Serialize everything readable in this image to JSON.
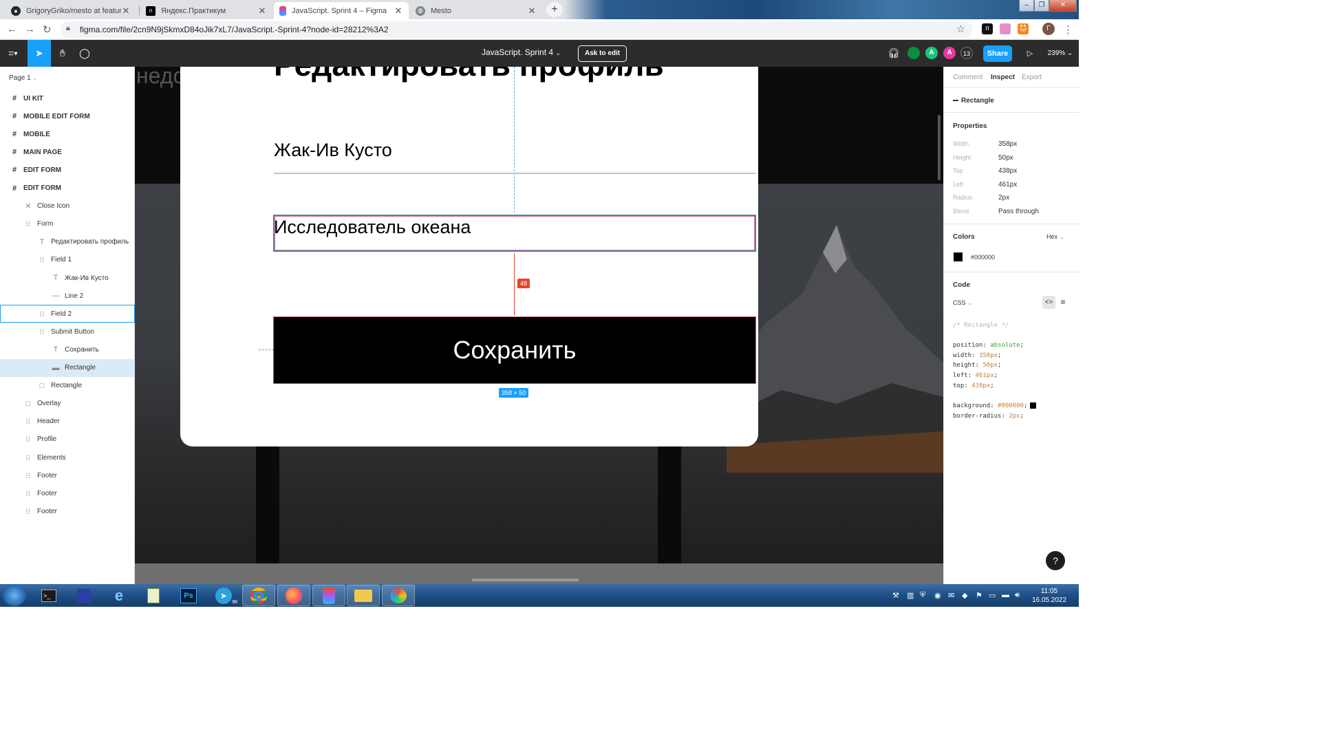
{
  "browser": {
    "tabs": [
      {
        "label": "GrigoryGriko/mesto at feature/he",
        "icon": "github-icon"
      },
      {
        "label": "Яндекс.Практикум",
        "icon": "yandex-praktikum-icon"
      },
      {
        "label": "JavaScript. Sprint 4 – Figma",
        "icon": "figma-icon",
        "active": true
      },
      {
        "label": "Mesto",
        "icon": "globe-icon"
      }
    ],
    "url": "figma.com/file/2cn9N9jSkmxD84oJik7xL7/JavaScript.-Sprint-4?node-id=28212%3A2",
    "profile_initial": "Г"
  },
  "figma": {
    "toolbar": {
      "doc_title": "JavaScript. Sprint 4",
      "ask_to_edit": "Ask to edit",
      "avatars": [
        {
          "label": "",
          "color": "#0b8e3b"
        },
        {
          "label": "A",
          "color": "#1bc47d"
        },
        {
          "label": "A",
          "color": "#e8389b"
        }
      ],
      "user_count": "13",
      "share": "Share",
      "zoom": "239%"
    },
    "left_panel": {
      "page": "Page 1",
      "layers": [
        {
          "label": "UI KIT",
          "icon": "#",
          "level": 0,
          "type": "frame"
        },
        {
          "label": "MOBILE EDIT FORM",
          "icon": "#",
          "level": 0,
          "type": "frame"
        },
        {
          "label": "MOBILE",
          "icon": "#",
          "level": 0,
          "type": "frame"
        },
        {
          "label": "MAIN PAGE",
          "icon": "#",
          "level": 0,
          "type": "frame"
        },
        {
          "label": "EDIT FORM",
          "icon": "#",
          "level": 0,
          "type": "frame"
        },
        {
          "label": "EDIT FORM",
          "icon": "#",
          "level": 0,
          "type": "frame"
        },
        {
          "label": "Close Icon",
          "icon": "✕",
          "level": 1,
          "type": "component"
        },
        {
          "label": "Form",
          "icon": "⁝⁝",
          "level": 1,
          "type": "group"
        },
        {
          "label": "Редактировать профиль",
          "icon": "T",
          "level": 2,
          "type": "text"
        },
        {
          "label": "Field 1",
          "icon": "⁝⁝",
          "level": 2,
          "type": "group"
        },
        {
          "label": "Жак-Ив Кусто",
          "icon": "T",
          "level": 3,
          "type": "text"
        },
        {
          "label": "Line 2",
          "icon": "—",
          "level": 3,
          "type": "line"
        },
        {
          "label": "Field 2",
          "icon": "⁝⁝",
          "level": 2,
          "type": "group",
          "state": "hover"
        },
        {
          "label": "Submit Button",
          "icon": "⁝⁝",
          "level": 2,
          "type": "group"
        },
        {
          "label": "Сохранить",
          "icon": "T",
          "level": 3,
          "type": "text"
        },
        {
          "label": "Rectangle",
          "icon": "▬",
          "level": 3,
          "type": "rectangle",
          "state": "selected"
        },
        {
          "label": "Rectangle",
          "icon": "□",
          "level": 2,
          "type": "rectangle"
        },
        {
          "label": "Overlay",
          "icon": "□",
          "level": 1,
          "type": "rectangle"
        },
        {
          "label": "Header",
          "icon": "⁝⁝",
          "level": 1,
          "type": "group"
        },
        {
          "label": "Profile",
          "icon": "⁝⁝",
          "level": 1,
          "type": "group"
        },
        {
          "label": "Elements",
          "icon": "⁝⁝",
          "level": 1,
          "type": "group"
        },
        {
          "label": "Footer",
          "icon": "⁝⁝",
          "level": 1,
          "type": "group"
        },
        {
          "label": "Footer",
          "icon": "⁝⁝",
          "level": 1,
          "type": "group"
        },
        {
          "label": "Footer",
          "icon": "⁝⁝",
          "level": 1,
          "type": "group"
        }
      ]
    },
    "canvas": {
      "ghost_text": "недо",
      "title": "Редактировать профиль",
      "field1": "Жак-Ив Кусто",
      "field2": "Исследователь океана",
      "submit": "Сохранить",
      "spacing_badge": "48",
      "size_badge": "358 × 50"
    },
    "right_panel": {
      "tabs": [
        "Comment",
        "Inspect",
        "Export"
      ],
      "active_tab": "Inspect",
      "selection": "Rectangle",
      "properties_title": "Properties",
      "properties": [
        {
          "key": "Width",
          "value": "358px"
        },
        {
          "key": "Height",
          "value": "50px"
        },
        {
          "key": "Top",
          "value": "438px"
        },
        {
          "key": "Left",
          "value": "461px"
        },
        {
          "key": "Radius",
          "value": "2px"
        },
        {
          "key": "Blend",
          "value": "Pass through"
        }
      ],
      "colors_title": "Colors",
      "color_format": "Hex",
      "color_value": "#000000",
      "code_title": "Code",
      "code_lang": "CSS",
      "code": {
        "comment": "/* Rectangle */",
        "lines": [
          {
            "prop": "position",
            "value": "absolute",
            "kind": "g"
          },
          {
            "prop": "width",
            "value": "358px",
            "kind": "v"
          },
          {
            "prop": "height",
            "value": "50px",
            "kind": "v"
          },
          {
            "prop": "left",
            "value": "461px",
            "kind": "v"
          },
          {
            "prop": "top",
            "value": "438px",
            "kind": "v"
          }
        ],
        "lines2": [
          {
            "prop": "background",
            "value": "#000000",
            "kind": "v",
            "swatch": true
          },
          {
            "prop": "border-radius",
            "value": "2px",
            "kind": "v"
          }
        ]
      },
      "help": "?"
    }
  },
  "taskbar": {
    "apps": [
      "terminal-icon",
      "save-icon",
      "ie-icon",
      "notepad-icon",
      "photoshop-icon",
      "telegram-icon",
      "chrome-icon",
      "firefox-icon",
      "figma-icon",
      "explorer-icon",
      "paint-icon"
    ],
    "photoshop_label": "Ps",
    "telegram_badge": "98",
    "time": "11:05",
    "date": "16.05.2022"
  }
}
